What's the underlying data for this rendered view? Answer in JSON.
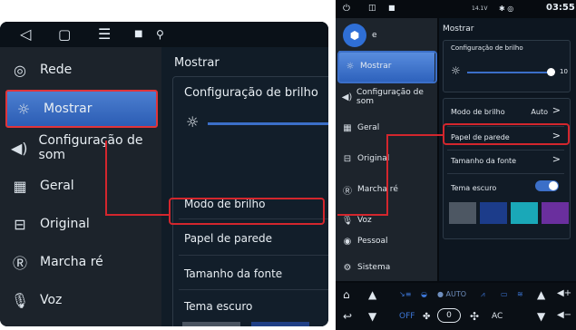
{
  "left": {
    "sidebar": [
      {
        "label": "Rede",
        "icon": "antenna-icon"
      },
      {
        "label": "Mostrar",
        "icon": "brightness-icon",
        "active": true
      },
      {
        "label": "Configuração de som",
        "icon": "speaker-icon"
      },
      {
        "label": "Geral",
        "icon": "grid-icon"
      },
      {
        "label": "Original",
        "icon": "car-icon"
      },
      {
        "label": "Marcha ré",
        "icon": "reverse-icon"
      },
      {
        "label": "Voz",
        "icon": "mic-icon"
      }
    ],
    "title": "Mostrar",
    "brightness_header": "Configuração de brilho",
    "rows": [
      "Modo de brilho",
      "Papel de parede",
      "Tamanho da fonte",
      "Tema escuro"
    ]
  },
  "right": {
    "status_time": "03:55",
    "status_voltage": "14.1V",
    "title": "Mostrar",
    "sidebar": [
      {
        "label": "e",
        "icon": "app-logo-icon"
      },
      {
        "label": "Mostrar",
        "icon": "brightness-icon",
        "active": true
      },
      {
        "label": "Configuração de som",
        "icon": "speaker-icon"
      },
      {
        "label": "Geral",
        "icon": "grid-icon"
      },
      {
        "label": "Original",
        "icon": "car-icon"
      },
      {
        "label": "Marcha ré",
        "icon": "reverse-icon"
      },
      {
        "label": "Voz",
        "icon": "mic-icon"
      },
      {
        "label": "Pessoal",
        "icon": "person-icon"
      },
      {
        "label": "Sistema",
        "icon": "system-icon"
      }
    ],
    "brightness_header": "Configuração de brilho",
    "brightness_value": "10",
    "brightness_level": 0.85,
    "modo_label": "Modo de brilho",
    "modo_value": "Auto",
    "papel_label": "Papel de parede",
    "tamanho_label": "Tamanho da fonte",
    "tema_label": "Tema escuro",
    "bottom": {
      "auto": "AUTO",
      "off": "OFF",
      "zero": "0",
      "ac": "AC"
    }
  },
  "colors": {
    "highlight": "#d3262d",
    "active_blue": "#3b6fc8"
  }
}
